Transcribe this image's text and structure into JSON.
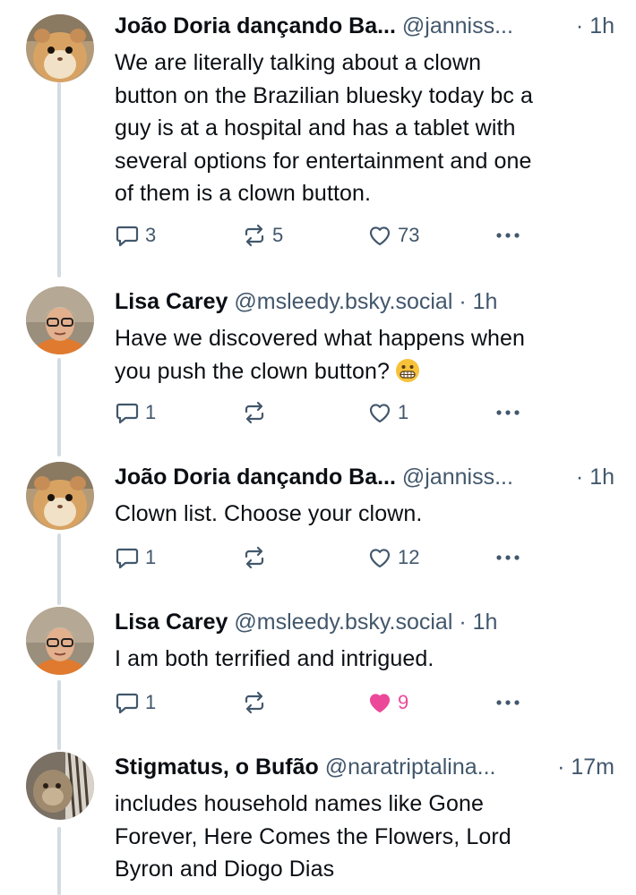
{
  "posts": [
    {
      "author": "João Doria dançando Ba...",
      "handle": "@janniss...",
      "separator": "·",
      "time": "1h",
      "text": "We are literally talking about a clown\nbutton on the Brazilian bluesky today bc a\nguy is at a hospital and has a tablet with\nseveral options for entertainment and one\nof them is a clown button.",
      "replies": "3",
      "reposts": "5",
      "likes": "73"
    },
    {
      "author": "Lisa Carey",
      "handle": "@msleedy.bsky.social",
      "separator": "·",
      "time": "1h",
      "text": "Have we discovered what happens when\nyou push the clown button?",
      "emoji": "grimacing-face",
      "replies": "1",
      "reposts": "",
      "likes": "1"
    },
    {
      "author": "João Doria dançando Ba...",
      "handle": "@janniss...",
      "separator": "·",
      "time": "1h",
      "text": "Clown list. Choose your clown.",
      "replies": "1",
      "reposts": "",
      "likes": "12"
    },
    {
      "author": "Lisa Carey",
      "handle": "@msleedy.bsky.social",
      "separator": "·",
      "time": "1h",
      "text": "I am both terrified and intrigued.",
      "replies": "1",
      "reposts": "",
      "likes": "9",
      "liked": true
    },
    {
      "author": "Stigmatus, o Bufão",
      "handle": "@naratriptalina...",
      "separator": "·",
      "time": "17m",
      "text": "includes household names like Gone\nForever, Here Comes the Flowers, Lord\nByron and Diogo Dias"
    }
  ],
  "icons": {
    "reply": "speech-bubble-icon",
    "repost": "repost-arrows-icon",
    "like": "heart-icon",
    "more": "ellipsis-icon"
  },
  "colors": {
    "text": "#0b0f14",
    "muted": "#42576c",
    "like_active": "#ec4899",
    "thread_line": "#d4dbe2"
  }
}
